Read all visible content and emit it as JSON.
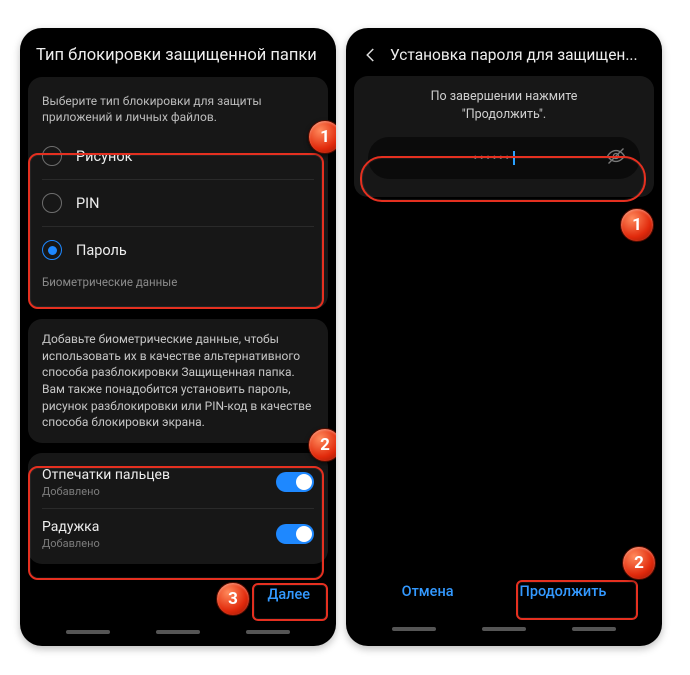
{
  "left": {
    "title": "Тип блокировки защищенной папки",
    "desc": "Выберите тип блокировки для защиты приложений и личных файлов.",
    "options": [
      {
        "label": "Рисунок",
        "selected": false
      },
      {
        "label": "PIN",
        "selected": false
      },
      {
        "label": "Пароль",
        "selected": true
      }
    ],
    "bio_header": "Биометрические данные",
    "bio_desc": "Добавьте биометрические данные, чтобы использовать их в качестве альтернативного способа разблокировки Защищенная папка. Вам также понадобится установить пароль, рисунок разблокировки или PIN-код в качестве способа блокировки экрана.",
    "bio_items": [
      {
        "label": "Отпечатки пальцев",
        "sub": "Добавлено",
        "on": true
      },
      {
        "label": "Радужка",
        "sub": "Добавлено",
        "on": true
      }
    ],
    "next": "Далее"
  },
  "right": {
    "title": "Установка пароля для защищен...",
    "hint_line1": "По завершении нажмите",
    "hint_line2": "\"Продолжить\".",
    "pw_value": "••••••",
    "cancel": "Отмена",
    "continue": "Продолжить"
  },
  "badges": {
    "b1": "1",
    "b2": "2",
    "b3": "3"
  }
}
